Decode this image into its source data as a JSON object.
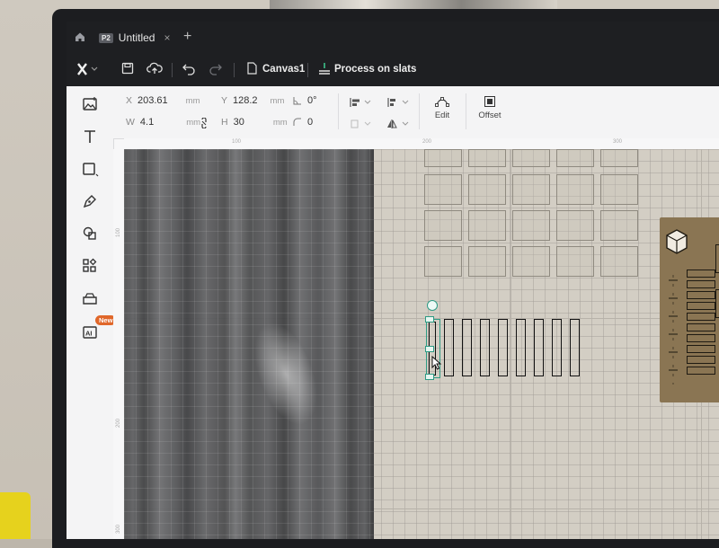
{
  "app": {
    "tab_badge": "P2",
    "tab_title": "Untitled",
    "tab_close": "×",
    "tab_add": "+"
  },
  "toolbar": {
    "canvas_name": "Canvas1",
    "process_label": "Process on slats"
  },
  "properties": {
    "x_label": "X",
    "x_value": "203.61",
    "x_unit": "mm",
    "y_label": "Y",
    "y_value": "128.2",
    "y_unit": "mm",
    "w_label": "W",
    "w_value": "4.1",
    "w_unit": "mm",
    "h_label": "H",
    "h_value": "30",
    "h_unit": "mm",
    "rotation_value": "0°",
    "corner_value": "0",
    "edit_label": "Edit",
    "offset_label": "Offset"
  },
  "left_toolbar": {
    "new_badge": "New",
    "items": [
      "image-icon",
      "text-icon",
      "shape-icon",
      "pen-icon",
      "combine-icon",
      "elements-icon",
      "material-icon",
      "ai-icon"
    ]
  },
  "rulers": {
    "top": [
      "100",
      "200",
      "300"
    ],
    "left": [
      "100",
      "200",
      "300"
    ]
  },
  "colors": {
    "titlebar": "#1e1f22",
    "panel": "#f4f4f5",
    "selection": "#2e9b84",
    "new_badge": "#e0672a"
  }
}
